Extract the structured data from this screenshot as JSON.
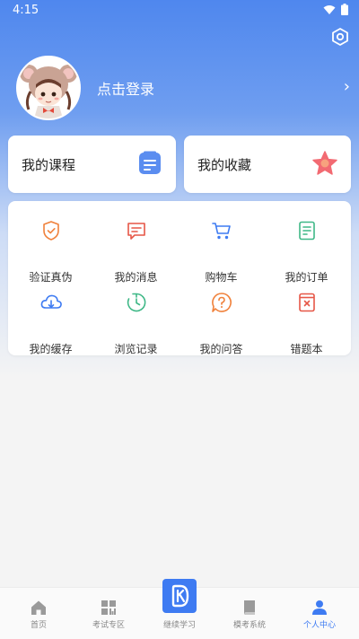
{
  "status_bar": {
    "time": "4:15"
  },
  "profile": {
    "login_text": "点击登录"
  },
  "cards": {
    "course": "我的课程",
    "favorites": "我的收藏"
  },
  "grid": [
    {
      "label": "验证真伪",
      "icon": "shield-check-icon"
    },
    {
      "label": "我的消息",
      "icon": "message-icon"
    },
    {
      "label": "购物车",
      "icon": "cart-icon"
    },
    {
      "label": "我的订单",
      "icon": "order-icon"
    },
    {
      "label": "我的缓存",
      "icon": "cloud-download-icon"
    },
    {
      "label": "浏览记录",
      "icon": "history-icon"
    },
    {
      "label": "我的问答",
      "icon": "question-icon"
    },
    {
      "label": "错题本",
      "icon": "wrong-notebook-icon"
    }
  ],
  "nav": [
    {
      "label": "首页",
      "icon": "home-icon"
    },
    {
      "label": "考试专区",
      "icon": "grid-icon"
    },
    {
      "label": "继续学习",
      "icon": "study-icon"
    },
    {
      "label": "模考系统",
      "icon": "book-icon"
    },
    {
      "label": "个人中心",
      "icon": "user-icon",
      "active": true
    }
  ],
  "colors": {
    "accent": "#3e7bf2",
    "orange": "#f0813b",
    "red": "#e65747",
    "blue": "#3e7bf2",
    "green": "#3fb887"
  }
}
